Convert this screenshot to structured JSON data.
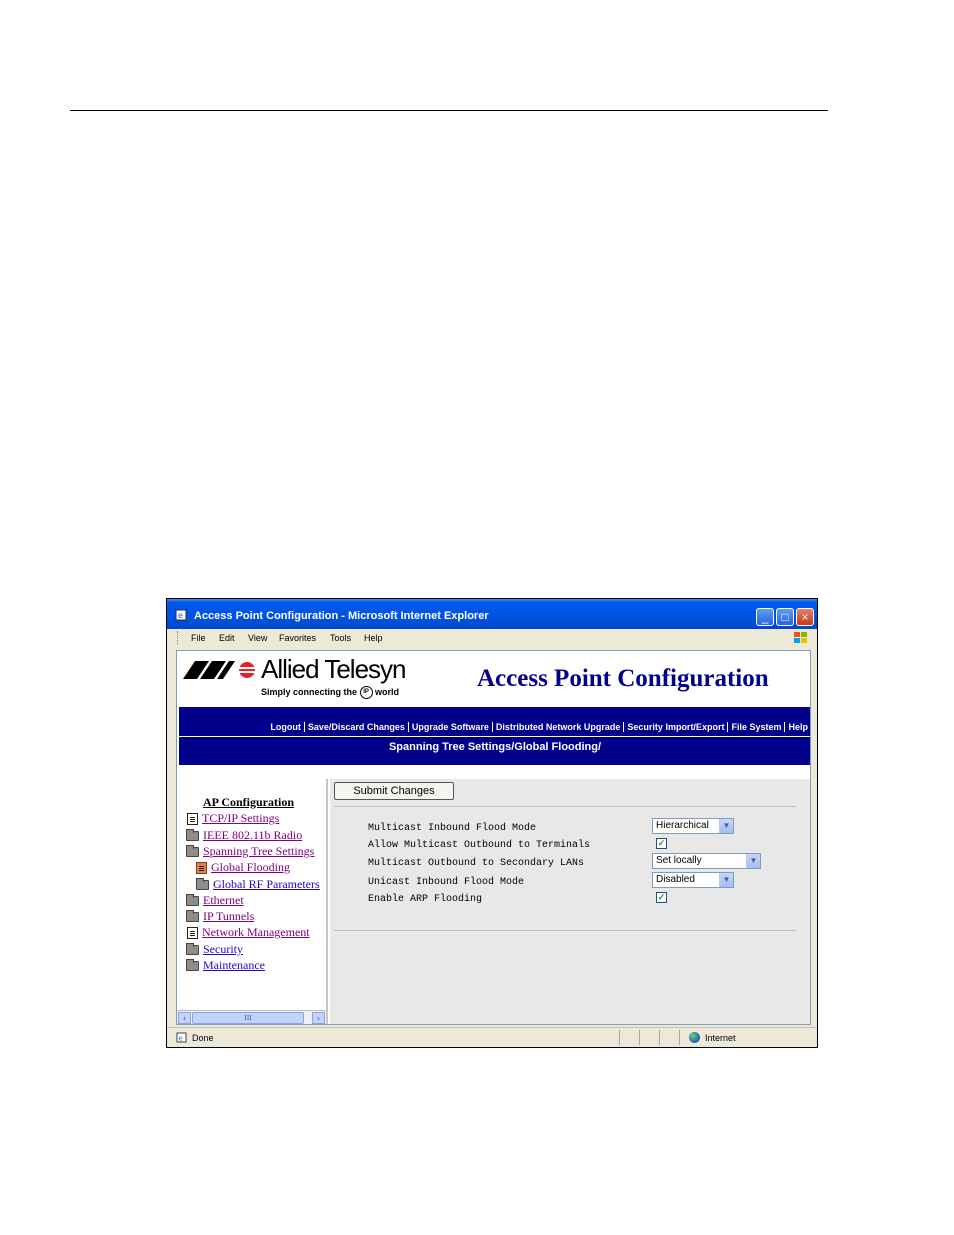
{
  "window": {
    "title": "Access Point Configuration - Microsoft Internet Explorer"
  },
  "menu": [
    "File",
    "Edit",
    "View",
    "Favorites",
    "Tools",
    "Help"
  ],
  "branding": {
    "company": "Allied Telesyn",
    "tagline_before": "Simply connecting the",
    "tagline_badge": "IP",
    "tagline_after": "world",
    "app_title": "Access Point Configuration"
  },
  "nav": {
    "links": [
      "Logout",
      "Save/Discard Changes",
      "Upgrade Software",
      "Distributed Network Upgrade",
      "Security Import/Export",
      "File System",
      "Help"
    ],
    "breadcrumb": "Spanning Tree Settings/Global Flooding/"
  },
  "tree": {
    "heading": "AP Configuration",
    "items": [
      {
        "label": "TCP/IP Settings",
        "icon": "document-icon"
      },
      {
        "label": "IEEE 802.11b Radio",
        "icon": "folder-icon"
      },
      {
        "label": "Spanning Tree Settings",
        "icon": "open-folder-icon"
      },
      {
        "label": "Global Flooding",
        "icon": "document-icon-active"
      },
      {
        "label": "Global RF Parameters",
        "icon": "folder-icon"
      },
      {
        "label": "Ethernet",
        "icon": "folder-icon"
      },
      {
        "label": "IP Tunnels",
        "icon": "folder-icon"
      },
      {
        "label": "Network Management",
        "icon": "document-icon"
      },
      {
        "label": "Security",
        "icon": "folder-icon"
      },
      {
        "label": "Maintenance",
        "icon": "folder-icon"
      }
    ],
    "scroll_thumb": "III"
  },
  "form": {
    "submit_label": "Submit Changes",
    "settings": [
      {
        "label": "Multicast Inbound Flood Mode",
        "type": "select",
        "value": "Hierarchical"
      },
      {
        "label": "Allow Multicast Outbound to Terminals",
        "type": "checkbox",
        "checked": true
      },
      {
        "label": "Multicast Outbound to Secondary LANs",
        "type": "select",
        "value": "Set locally"
      },
      {
        "label": "Unicast Inbound Flood Mode",
        "type": "select",
        "value": "Disabled"
      },
      {
        "label": "Enable ARP Flooding",
        "type": "checkbox",
        "checked": true
      }
    ]
  },
  "status": {
    "text": "Done",
    "zone": "Internet"
  },
  "colors": {
    "nav_band": "#00008b",
    "app_title": "#00008b",
    "link": "#2a00c8",
    "visited_link": "#800080",
    "titlebar": "#0054e3"
  }
}
